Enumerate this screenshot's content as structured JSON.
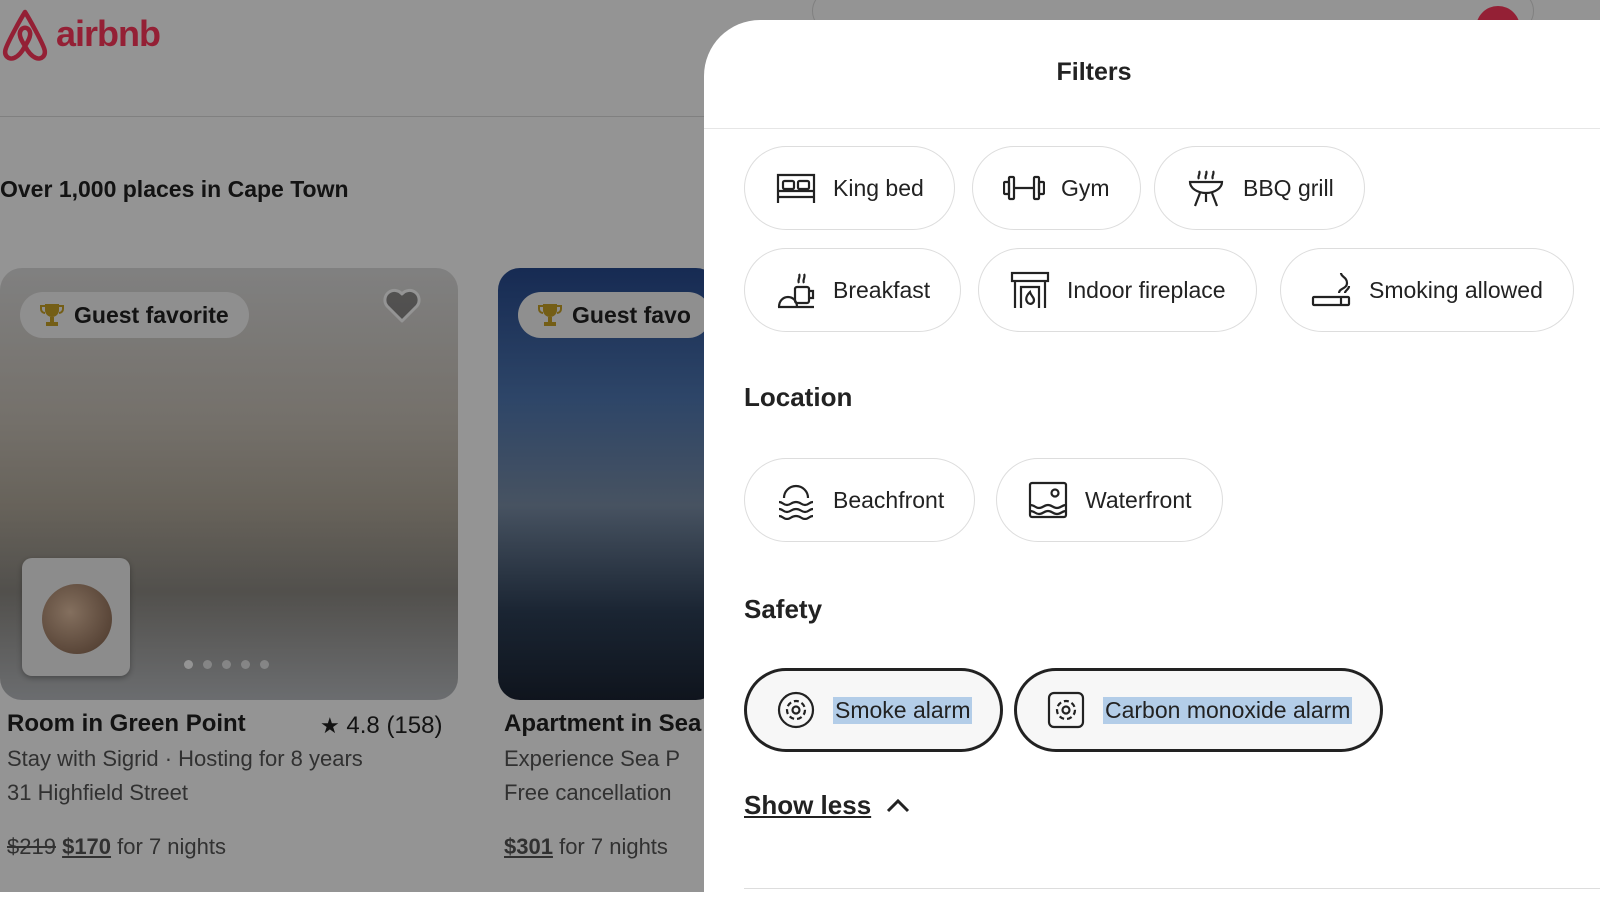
{
  "brand": {
    "name": "airbnb",
    "color": "#FF385C"
  },
  "page": {
    "results_heading": "Over 1,000 places in Cape Town"
  },
  "listings": [
    {
      "badge": "Guest favorite",
      "title": "Room in Green Point",
      "rating": "4.8 (158)",
      "line1": "Stay with Sigrid · Hosting for 8 years",
      "line2": "31 Highfield Street",
      "old_price": "$219",
      "price": "$170",
      "price_suffix": "for 7 nights"
    },
    {
      "badge": "Guest favo",
      "title": "Apartment in Sea",
      "line1": "Experience Sea P",
      "line2": "Free cancellation",
      "price": "$301",
      "price_suffix": "for 7 nights"
    }
  ],
  "filters": {
    "title": "Filters",
    "amenities": [
      {
        "label": "King bed",
        "icon": "bed-icon"
      },
      {
        "label": "Gym",
        "icon": "dumbbell-icon"
      },
      {
        "label": "BBQ grill",
        "icon": "bbq-grill-icon"
      },
      {
        "label": "Breakfast",
        "icon": "breakfast-icon"
      },
      {
        "label": "Indoor fireplace",
        "icon": "fireplace-icon"
      },
      {
        "label": "Smoking allowed",
        "icon": "smoking-icon"
      }
    ],
    "location": {
      "heading": "Location",
      "items": [
        {
          "label": "Beachfront",
          "icon": "beach-icon"
        },
        {
          "label": "Waterfront",
          "icon": "waterfront-icon"
        }
      ]
    },
    "safety": {
      "heading": "Safety",
      "items": [
        {
          "label": "Smoke alarm",
          "icon": "smoke-alarm-icon",
          "selected": true
        },
        {
          "label": "Carbon monoxide alarm",
          "icon": "co-alarm-icon",
          "selected": true
        }
      ]
    },
    "show_less": "Show less"
  }
}
